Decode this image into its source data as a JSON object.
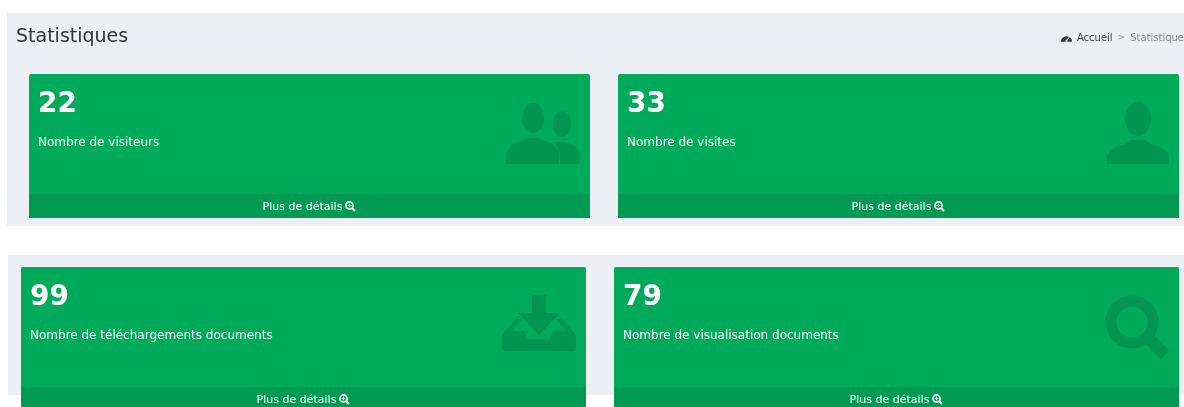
{
  "header": {
    "title": "Statistiques",
    "separator": ">",
    "breadcrumb": [
      {
        "label": "Accueil",
        "kind": "home"
      },
      {
        "label": "Statistique",
        "kind": "current"
      }
    ]
  },
  "sections": [
    {
      "cards": [
        {
          "value": "22",
          "label": "Nombre de visiteurs",
          "kind": "users",
          "link": "Plus de détails"
        },
        {
          "value": "33",
          "label": "Nombre de visites",
          "kind": "user",
          "link": "Plus de détails"
        }
      ]
    },
    {
      "cards": [
        {
          "value": "99",
          "label": "Nombre de téléchargements documents",
          "kind": "download",
          "link": "Plus de détails"
        },
        {
          "value": "79",
          "label": "Nombre de visualisation documents",
          "kind": "search",
          "link": "Plus de détails"
        }
      ]
    }
  ]
}
